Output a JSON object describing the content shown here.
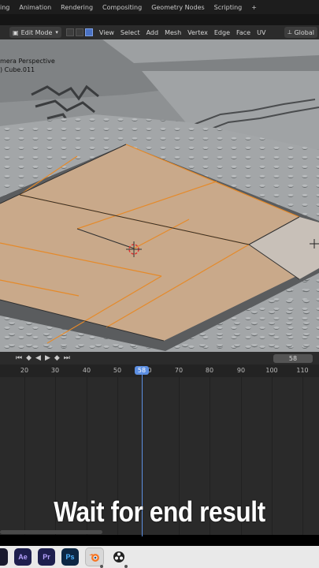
{
  "workspace_tabs": [
    "ing",
    "Animation",
    "Rendering",
    "Compositing",
    "Geometry Nodes",
    "Scripting",
    "+"
  ],
  "header": {
    "mode": "Edit Mode",
    "menus": [
      "View",
      "Select",
      "Add",
      "Mesh",
      "Vertex",
      "Edge",
      "Face",
      "UV"
    ],
    "transform_orientation": "Global"
  },
  "viewport": {
    "perspective_label": "mera Perspective",
    "object_label": ") Cube.011",
    "colors": {
      "face_selected": "#c9a98a",
      "edge_selected": "#e58a2a",
      "floor": "#9a9d9f"
    }
  },
  "timeline": {
    "current_frame": "58",
    "ruler_ticks": [
      "20",
      "30",
      "40",
      "50",
      "58",
      "0",
      "70",
      "80",
      "90",
      "100",
      "110"
    ],
    "playhead_color": "#5d8fe2"
  },
  "caption": "Wait for end result",
  "dock": {
    "apps": [
      {
        "label": "",
        "icon": "app-icon"
      },
      {
        "label": "Ae",
        "icon": "after-effects-icon"
      },
      {
        "label": "Pr",
        "icon": "premiere-icon"
      },
      {
        "label": "Ps",
        "icon": "photoshop-icon"
      },
      {
        "label": "",
        "icon": "blender-icon"
      },
      {
        "label": "",
        "icon": "obs-icon"
      }
    ]
  }
}
